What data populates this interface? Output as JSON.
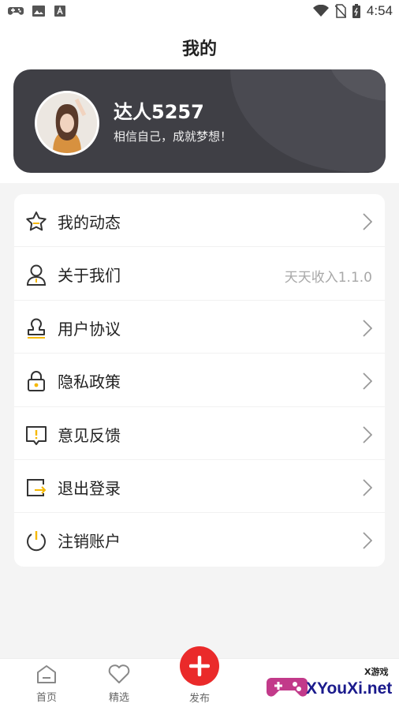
{
  "status_bar": {
    "time": "4:54",
    "icons": [
      "gamepad-icon",
      "image-icon",
      "text-icon",
      "wifi-icon",
      "no-sim-icon",
      "battery-icon"
    ]
  },
  "page": {
    "title": "我的"
  },
  "profile": {
    "username": "达人5257",
    "motto": "相信自己，成就梦想！"
  },
  "menu": {
    "items": [
      {
        "label": "我的动态",
        "icon": "star-icon",
        "trailing": "arrow"
      },
      {
        "label": "关于我们",
        "icon": "user-icon",
        "trailing": "text",
        "value": "天天收入1.1.0"
      },
      {
        "label": "用户协议",
        "icon": "stamp-icon",
        "trailing": "arrow"
      },
      {
        "label": "隐私政策",
        "icon": "lock-icon",
        "trailing": "arrow"
      },
      {
        "label": "意见反馈",
        "icon": "feedback-icon",
        "trailing": "arrow"
      },
      {
        "label": "退出登录",
        "icon": "logout-icon",
        "trailing": "arrow"
      },
      {
        "label": "注销账户",
        "icon": "power-icon",
        "trailing": "arrow"
      }
    ]
  },
  "tabbar": {
    "tabs": [
      {
        "label": "首页",
        "icon": "home-icon"
      },
      {
        "label": "精选",
        "icon": "heart-icon"
      },
      {
        "label": "发布",
        "icon": "plus-icon"
      }
    ]
  },
  "watermark": {
    "small": "X游戏",
    "main": "XYouXi.net"
  },
  "colors": {
    "accent": "#f5b800",
    "card": "#3f3f45",
    "publish": "#ea2a2a"
  }
}
